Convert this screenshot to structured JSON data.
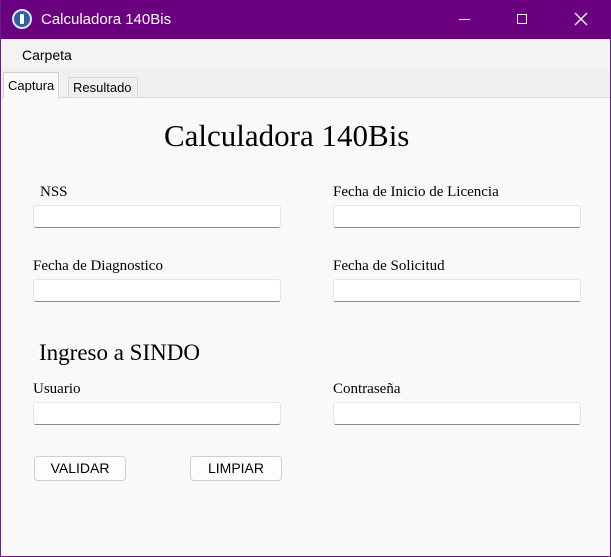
{
  "window": {
    "title": "Calculadora 140Bis",
    "icon": "app-icon"
  },
  "menubar": {
    "items": [
      {
        "label": "Carpeta"
      }
    ]
  },
  "tabs": [
    {
      "label": "Captura",
      "active": true
    },
    {
      "label": "Resultado",
      "active": false
    }
  ],
  "form": {
    "heading": "Calculadora 140Bis",
    "nss": {
      "label": "NSS",
      "value": ""
    },
    "fecha_inicio_licencia": {
      "label": "Fecha de Inicio de Licencia",
      "value": ""
    },
    "fecha_diagnostico": {
      "label": "Fecha de Diagnostico",
      "value": ""
    },
    "fecha_solicitud": {
      "label": "Fecha de Solicitud",
      "value": ""
    }
  },
  "sindo": {
    "heading": "Ingreso a SINDO",
    "usuario": {
      "label": "Usuario",
      "value": ""
    },
    "contrasena": {
      "label": "Contraseña",
      "value": ""
    }
  },
  "buttons": {
    "validar": "VALIDAR",
    "limpiar": "LIMPIAR"
  },
  "colors": {
    "titlebar": "#6a0080",
    "panel": "#f9f9f9",
    "window_bg": "#f0f0f0"
  }
}
